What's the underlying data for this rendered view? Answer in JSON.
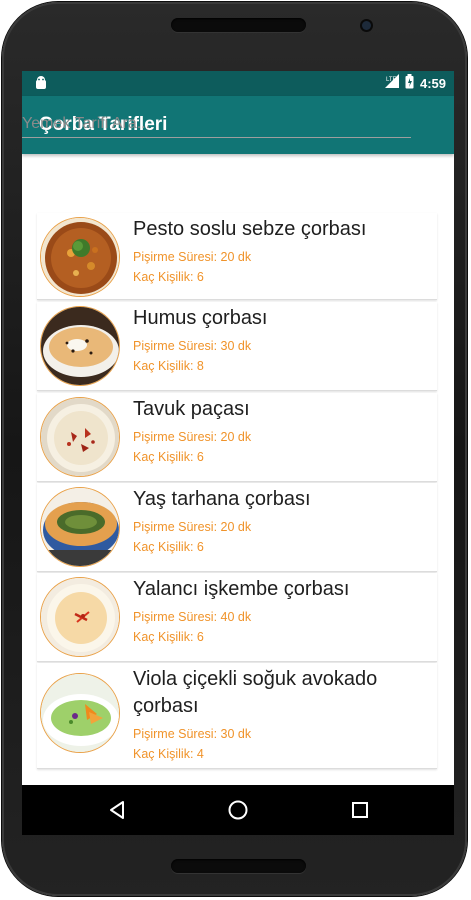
{
  "status_bar": {
    "time": "4:59"
  },
  "app_bar": {
    "title": "Çorba Tarifleri"
  },
  "search": {
    "placeholder": "Yemek Tarifi Ara..."
  },
  "recipes": [
    {
      "title": "Pesto soslu sebze çorbası",
      "cook_time": "Pişirme Süresi: 20 dk",
      "servings": "Kaç Kişilik: 6"
    },
    {
      "title": "Humus çorbası",
      "cook_time": "Pişirme Süresi: 30 dk",
      "servings": "Kaç Kişilik: 8"
    },
    {
      "title": "Tavuk paçası",
      "cook_time": "Pişirme Süresi: 20 dk",
      "servings": "Kaç Kişilik: 6"
    },
    {
      "title": "Yaş tarhana çorbası",
      "cook_time": "Pişirme Süresi: 20 dk",
      "servings": "Kaç Kişilik: 6"
    },
    {
      "title": "Yalancı işkembe çorbası",
      "cook_time": "Pişirme Süresi: 40 dk",
      "servings": "Kaç Kişilik: 6"
    },
    {
      "title": "Viola çiçekli soğuk avokado çorbası",
      "cook_time": "Pişirme Süresi: 30 dk",
      "servings": "Kaç Kişilik: 4"
    }
  ],
  "colors": {
    "status_bar": "#0d5c5c",
    "app_bar": "#117575",
    "meta_text": "#f0932a",
    "thumb_border": "#e9a24a"
  },
  "icons": [
    "android-icon",
    "signal-icon",
    "battery-icon",
    "back-icon",
    "home-icon",
    "recents-icon"
  ]
}
